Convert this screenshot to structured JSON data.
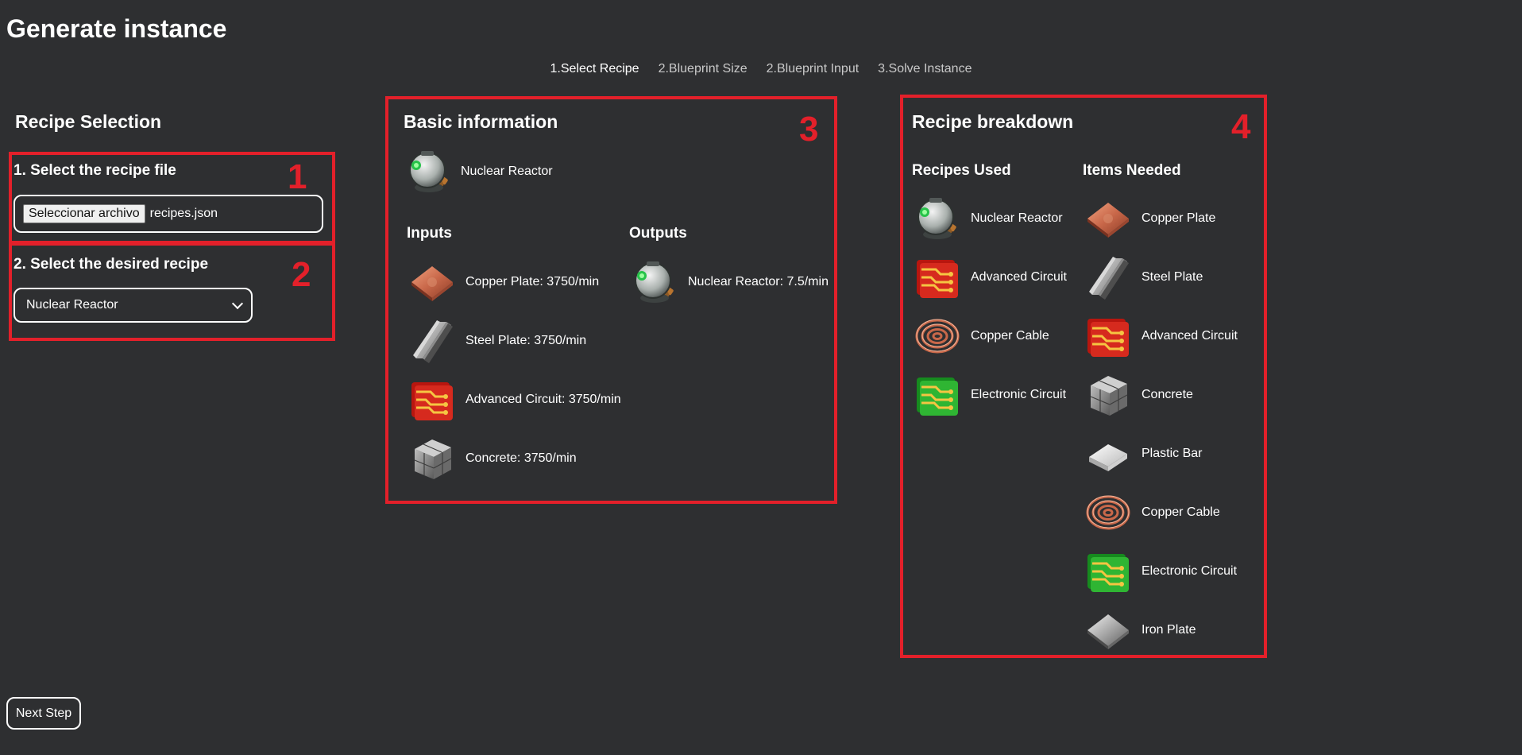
{
  "page": {
    "title": "Generate instance"
  },
  "steps": [
    "1.Select Recipe",
    "2.Blueprint Size",
    "2.Blueprint Input",
    "3.Solve Instance"
  ],
  "recipe_selection": {
    "title": "Recipe Selection",
    "file": {
      "label": "1. Select the recipe file",
      "button": "Seleccionar archivo",
      "filename": "recipes.json"
    },
    "recipe": {
      "label": "2. Select the desired recipe",
      "selected": "Nuclear Reactor"
    }
  },
  "basic_info": {
    "title": "Basic information",
    "product": "Nuclear Reactor",
    "inputs_title": "Inputs",
    "outputs_title": "Outputs",
    "inputs": [
      {
        "icon": "copper-plate-icon",
        "text": "Copper Plate: 3750/min"
      },
      {
        "icon": "steel-plate-icon",
        "text": "Steel Plate: 3750/min"
      },
      {
        "icon": "advanced-circuit-icon",
        "text": "Advanced Circuit: 3750/min"
      },
      {
        "icon": "concrete-icon",
        "text": "Concrete: 3750/min"
      }
    ],
    "outputs": [
      {
        "icon": "nuclear-reactor-icon",
        "text": "Nuclear Reactor: 7.5/min"
      }
    ]
  },
  "breakdown": {
    "title": "Recipe breakdown",
    "recipes_title": "Recipes Used",
    "items_title": "Items Needed",
    "recipes": [
      {
        "icon": "nuclear-reactor-icon",
        "name": "Nuclear Reactor"
      },
      {
        "icon": "advanced-circuit-icon",
        "name": "Advanced Circuit"
      },
      {
        "icon": "copper-cable-icon",
        "name": "Copper Cable"
      },
      {
        "icon": "electronic-circuit-icon",
        "name": "Electronic Circuit"
      }
    ],
    "items": [
      {
        "icon": "copper-plate-icon",
        "name": "Copper Plate"
      },
      {
        "icon": "steel-plate-icon",
        "name": "Steel Plate"
      },
      {
        "icon": "advanced-circuit-icon",
        "name": "Advanced Circuit"
      },
      {
        "icon": "concrete-icon",
        "name": "Concrete"
      },
      {
        "icon": "plastic-bar-icon",
        "name": "Plastic Bar"
      },
      {
        "icon": "copper-cable-icon",
        "name": "Copper Cable"
      },
      {
        "icon": "electronic-circuit-icon",
        "name": "Electronic Circuit"
      },
      {
        "icon": "iron-plate-icon",
        "name": "Iron Plate"
      }
    ]
  },
  "annotations": [
    "1",
    "2",
    "3",
    "4"
  ],
  "next_button": "Next Step",
  "colors": {
    "background": "#2e2f31",
    "annotation": "#e3202a",
    "text": "#ffffff"
  }
}
